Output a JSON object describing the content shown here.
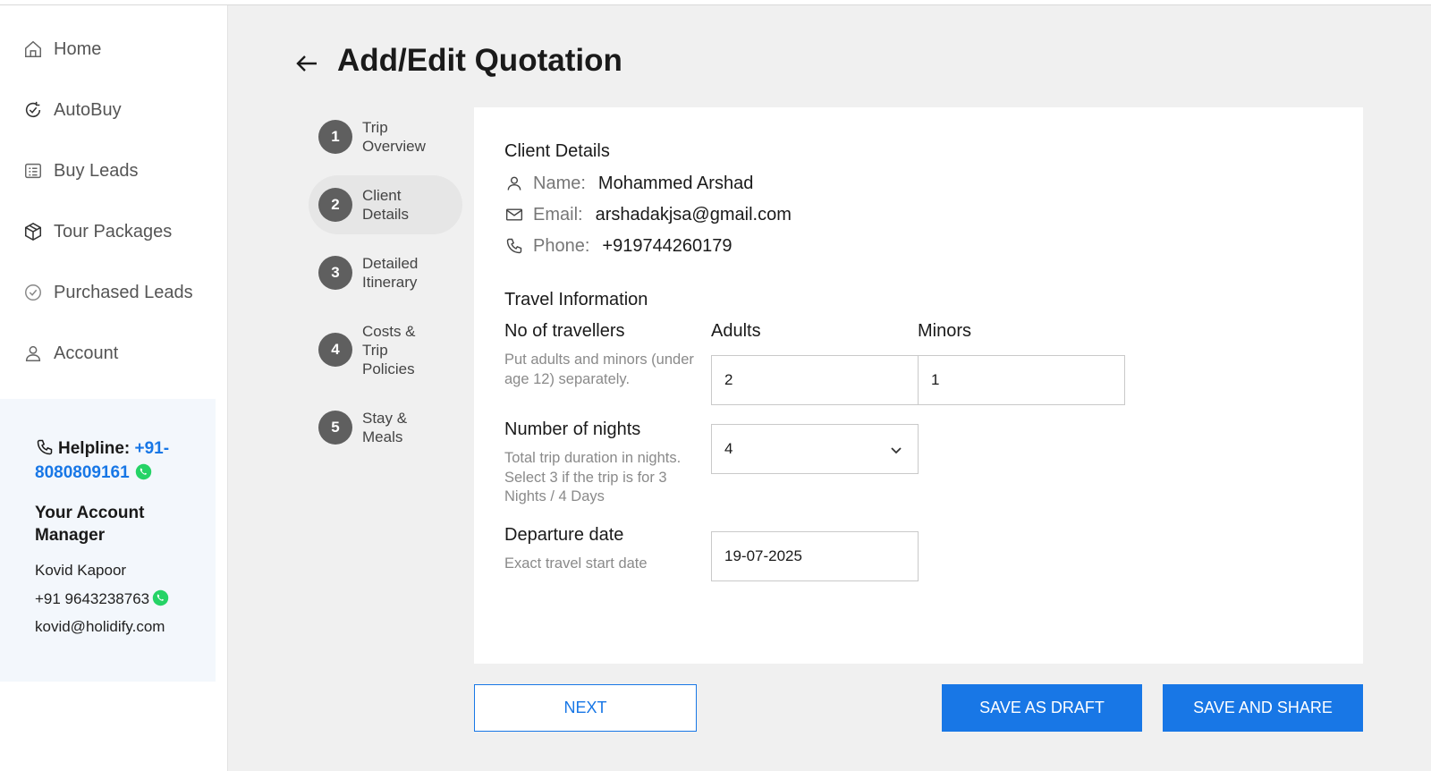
{
  "sidebar": {
    "items": [
      {
        "label": "Home",
        "icon": "home-icon"
      },
      {
        "label": "AutoBuy",
        "icon": "autobuy-icon"
      },
      {
        "label": "Buy Leads",
        "icon": "list-icon"
      },
      {
        "label": "Tour Packages",
        "icon": "package-icon"
      },
      {
        "label": "Purchased Leads",
        "icon": "check-circle-icon"
      },
      {
        "label": "Account",
        "icon": "user-icon"
      }
    ],
    "helpline": {
      "label": "Helpline:",
      "number": "+91-8080809161"
    },
    "account_manager": {
      "title": "Your Account Manager",
      "name": "Kovid Kapoor",
      "phone": "+91 9643238763",
      "email": "kovid@holidify.com"
    }
  },
  "header": {
    "title": "Add/Edit Quotation"
  },
  "steps": [
    {
      "number": "1",
      "label": "Trip Overview"
    },
    {
      "number": "2",
      "label": "Client Details"
    },
    {
      "number": "3",
      "label": "Detailed Itinerary"
    },
    {
      "number": "4",
      "label": "Costs & Trip Policies"
    },
    {
      "number": "5",
      "label": "Stay & Meals"
    }
  ],
  "client": {
    "title": "Client Details",
    "name_label": "Name:",
    "name": "Mohammed Arshad",
    "email_label": "Email:",
    "email": "arshadakjsa@gmail.com",
    "phone_label": "Phone:",
    "phone": "+919744260179"
  },
  "travel": {
    "title": "Travel Information",
    "travellers_label": "No of travellers",
    "travellers_help": "Put adults and minors (under age 12) separately.",
    "adults_label": "Adults",
    "adults_value": "2",
    "minors_label": "Minors",
    "minors_value": "1",
    "nights_label": "Number of nights",
    "nights_help": "Total trip duration in nights. Select 3 if the trip is for 3 Nights / 4 Days",
    "nights_value": "4",
    "departure_label": "Departure date",
    "departure_help": "Exact travel start date",
    "departure_value": "19-07-2025"
  },
  "buttons": {
    "next": "NEXT",
    "save_draft": "SAVE AS DRAFT",
    "save_share": "SAVE AND SHARE"
  },
  "colors": {
    "accent": "#1877e6",
    "whatsapp": "#25d366"
  }
}
